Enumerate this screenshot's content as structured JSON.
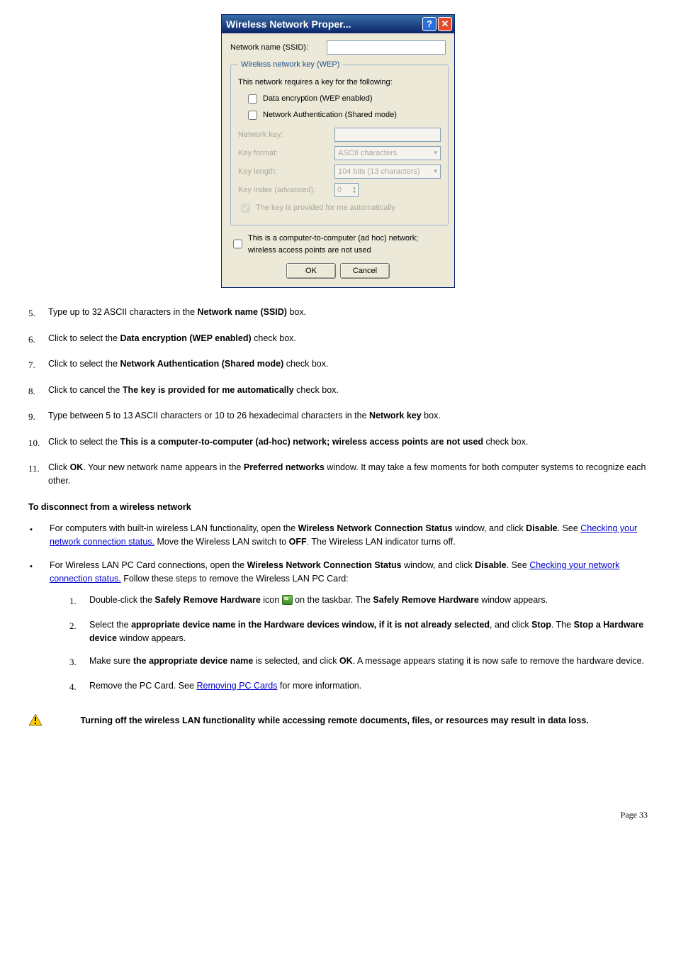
{
  "dialog": {
    "title": "Wireless Network Proper...",
    "ssid_label": "Network name (SSID):",
    "legend": "Wireless network key (WEP)",
    "requires": "This network requires a key for the following:",
    "cb_data_enc": "Data encryption (WEP enabled)",
    "cb_net_auth": "Network Authentication (Shared mode)",
    "net_key_label": "Network key:",
    "key_format_label": "Key format:",
    "key_format_value": "ASCII characters",
    "key_length_label": "Key length:",
    "key_length_value": "104 bits (13 characters)",
    "key_index_label": "Key index (advanced):",
    "key_index_value": "0",
    "cb_auto": "The key is provided for me automatically",
    "cb_adhoc": "This is a computer-to-computer (ad hoc) network; wireless access points are not used",
    "ok": "OK",
    "cancel": "Cancel"
  },
  "steps": [
    {
      "n": "5.",
      "html": "Type up to 32 ASCII characters in the <b>Network name (SSID)</b> box."
    },
    {
      "n": "6.",
      "html": "Click to select the <b>Data encryption (WEP enabled)</b> check box."
    },
    {
      "n": "7.",
      "html": "Click to select the <b>Network Authentication (Shared mode)</b> check box."
    },
    {
      "n": "8.",
      "html": "Click to cancel the <b>The key is provided for me automatically</b> check box."
    },
    {
      "n": "9.",
      "html": "Type between 5 to 13 ASCII characters or 10 to 26 hexadecimal characters in the <b>Network key</b> box."
    },
    {
      "n": "10.",
      "html": "Click to select the <b>This is a computer-to-computer (ad-hoc) network; wireless access points are not used</b> check box."
    },
    {
      "n": "11.",
      "html": "Click <b>OK</b>. Your new network name appears in the <b>Preferred networks</b> window. It may take a few moments for both computer systems to recognize each other."
    }
  ],
  "disconnect_heading": "To disconnect from a wireless network",
  "bullets": [
    {
      "html": "For computers with built-in wireless LAN functionality, open the <b>Wireless Network Connection Status</b> window, and click <b>Disable</b>. See <a class='link' href='#'>Checking your network connection status.</a> Move the Wireless LAN switch to <b>OFF</b>. The Wireless LAN indicator turns off."
    },
    {
      "html": "For Wireless LAN PC Card connections, open the <b>Wireless Network Connection Status</b> window, and click <b>Disable</b>. See <a class='link' href='#'>Checking your network connection status.</a> Follow these steps to remove the Wireless LAN PC Card:"
    }
  ],
  "substeps": [
    {
      "n": "1.",
      "html": "Double-click the <b>Safely Remove Hardware</b> icon <span class='tray-icon' data-name='tray-icon' data-interactable='false'></span> on the taskbar. The <b>Safely Remove Hardware</b> window appears."
    },
    {
      "n": "2.",
      "html": "Select the <b>appropriate device name in the Hardware devices window, if it is not already selected</b>, and click <b>Stop</b>. The <b>Stop a Hardware device</b> window appears."
    },
    {
      "n": "3.",
      "html": "Make sure <b>the appropriate device name</b> is selected, and click <b>OK</b>. A message appears stating it is now safe to remove the hardware device."
    },
    {
      "n": "4.",
      "html": "Remove the PC Card. See <a class='link' href='#'>Removing PC Cards</a> for more information."
    }
  ],
  "warning": "Turning off the wireless LAN functionality while accessing remote documents, files, or resources may result in data loss.",
  "page": "Page 33"
}
